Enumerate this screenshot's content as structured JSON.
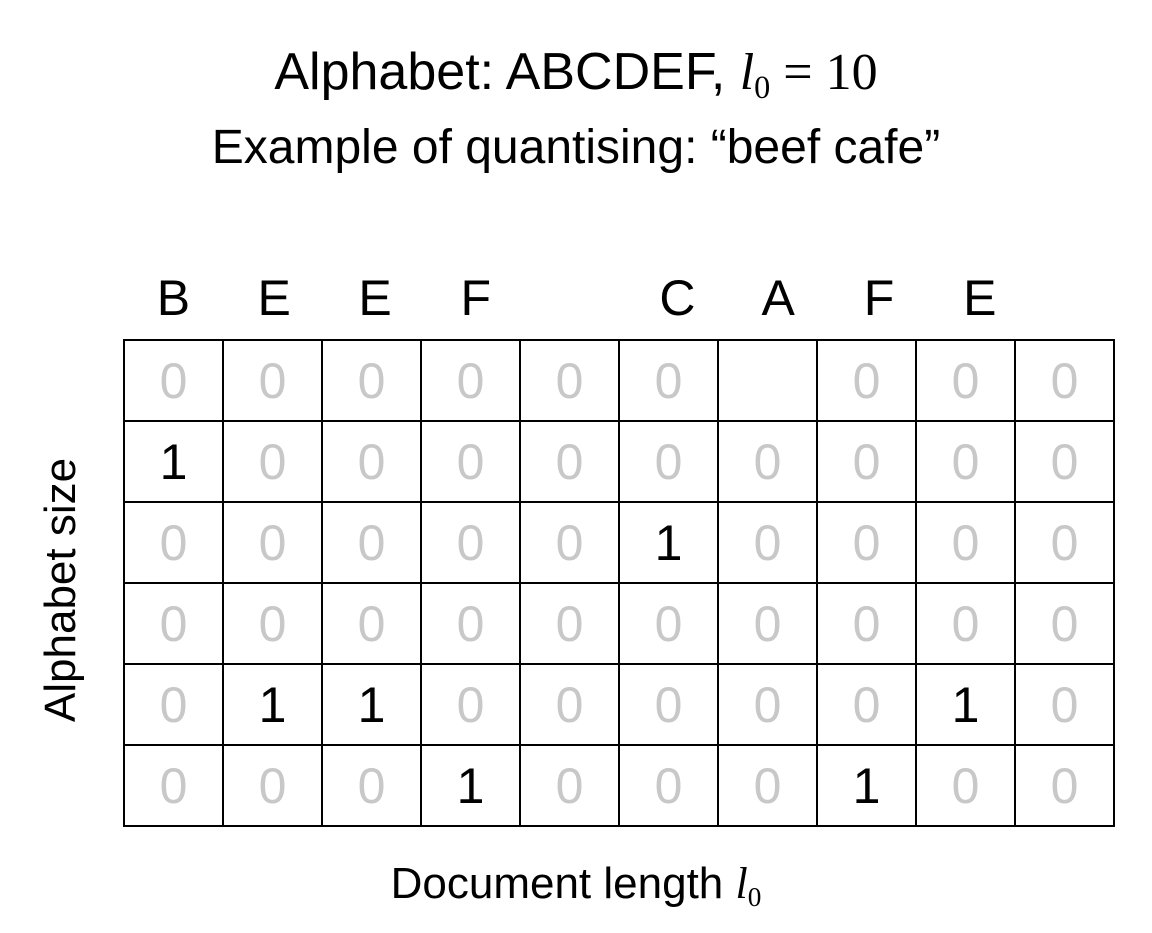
{
  "title": {
    "prefix": "Alphabet: ABCDEF, ",
    "math_var": "l",
    "math_sub": "0",
    "math_rest": " = 10",
    "subtitle": "Example of quantising: “beef cafe”"
  },
  "column_letters": [
    "B",
    "E",
    "E",
    "F",
    "",
    "C",
    "A",
    "F",
    "E",
    ""
  ],
  "grid": {
    "rows": [
      [
        "0",
        "0",
        "0",
        "0",
        "0",
        "0",
        "",
        "0",
        "0",
        "0"
      ],
      [
        "1",
        "0",
        "0",
        "0",
        "0",
        "0",
        "0",
        "0",
        "0",
        "0"
      ],
      [
        "0",
        "0",
        "0",
        "0",
        "0",
        "1",
        "0",
        "0",
        "0",
        "0"
      ],
      [
        "0",
        "0",
        "0",
        "0",
        "0",
        "0",
        "0",
        "0",
        "0",
        "0"
      ],
      [
        "0",
        "1",
        "1",
        "0",
        "0",
        "0",
        "0",
        "0",
        "1",
        "0"
      ],
      [
        "0",
        "0",
        "0",
        "1",
        "0",
        "0",
        "0",
        "1",
        "0",
        "0"
      ]
    ],
    "zero_color": "#c8c8c8",
    "one_color": "#000000",
    "border_color": "#000000"
  },
  "y_axis_label": "Alphabet size",
  "x_axis_label": {
    "text": "Document length ",
    "math_var": "l",
    "math_sub": "0"
  }
}
